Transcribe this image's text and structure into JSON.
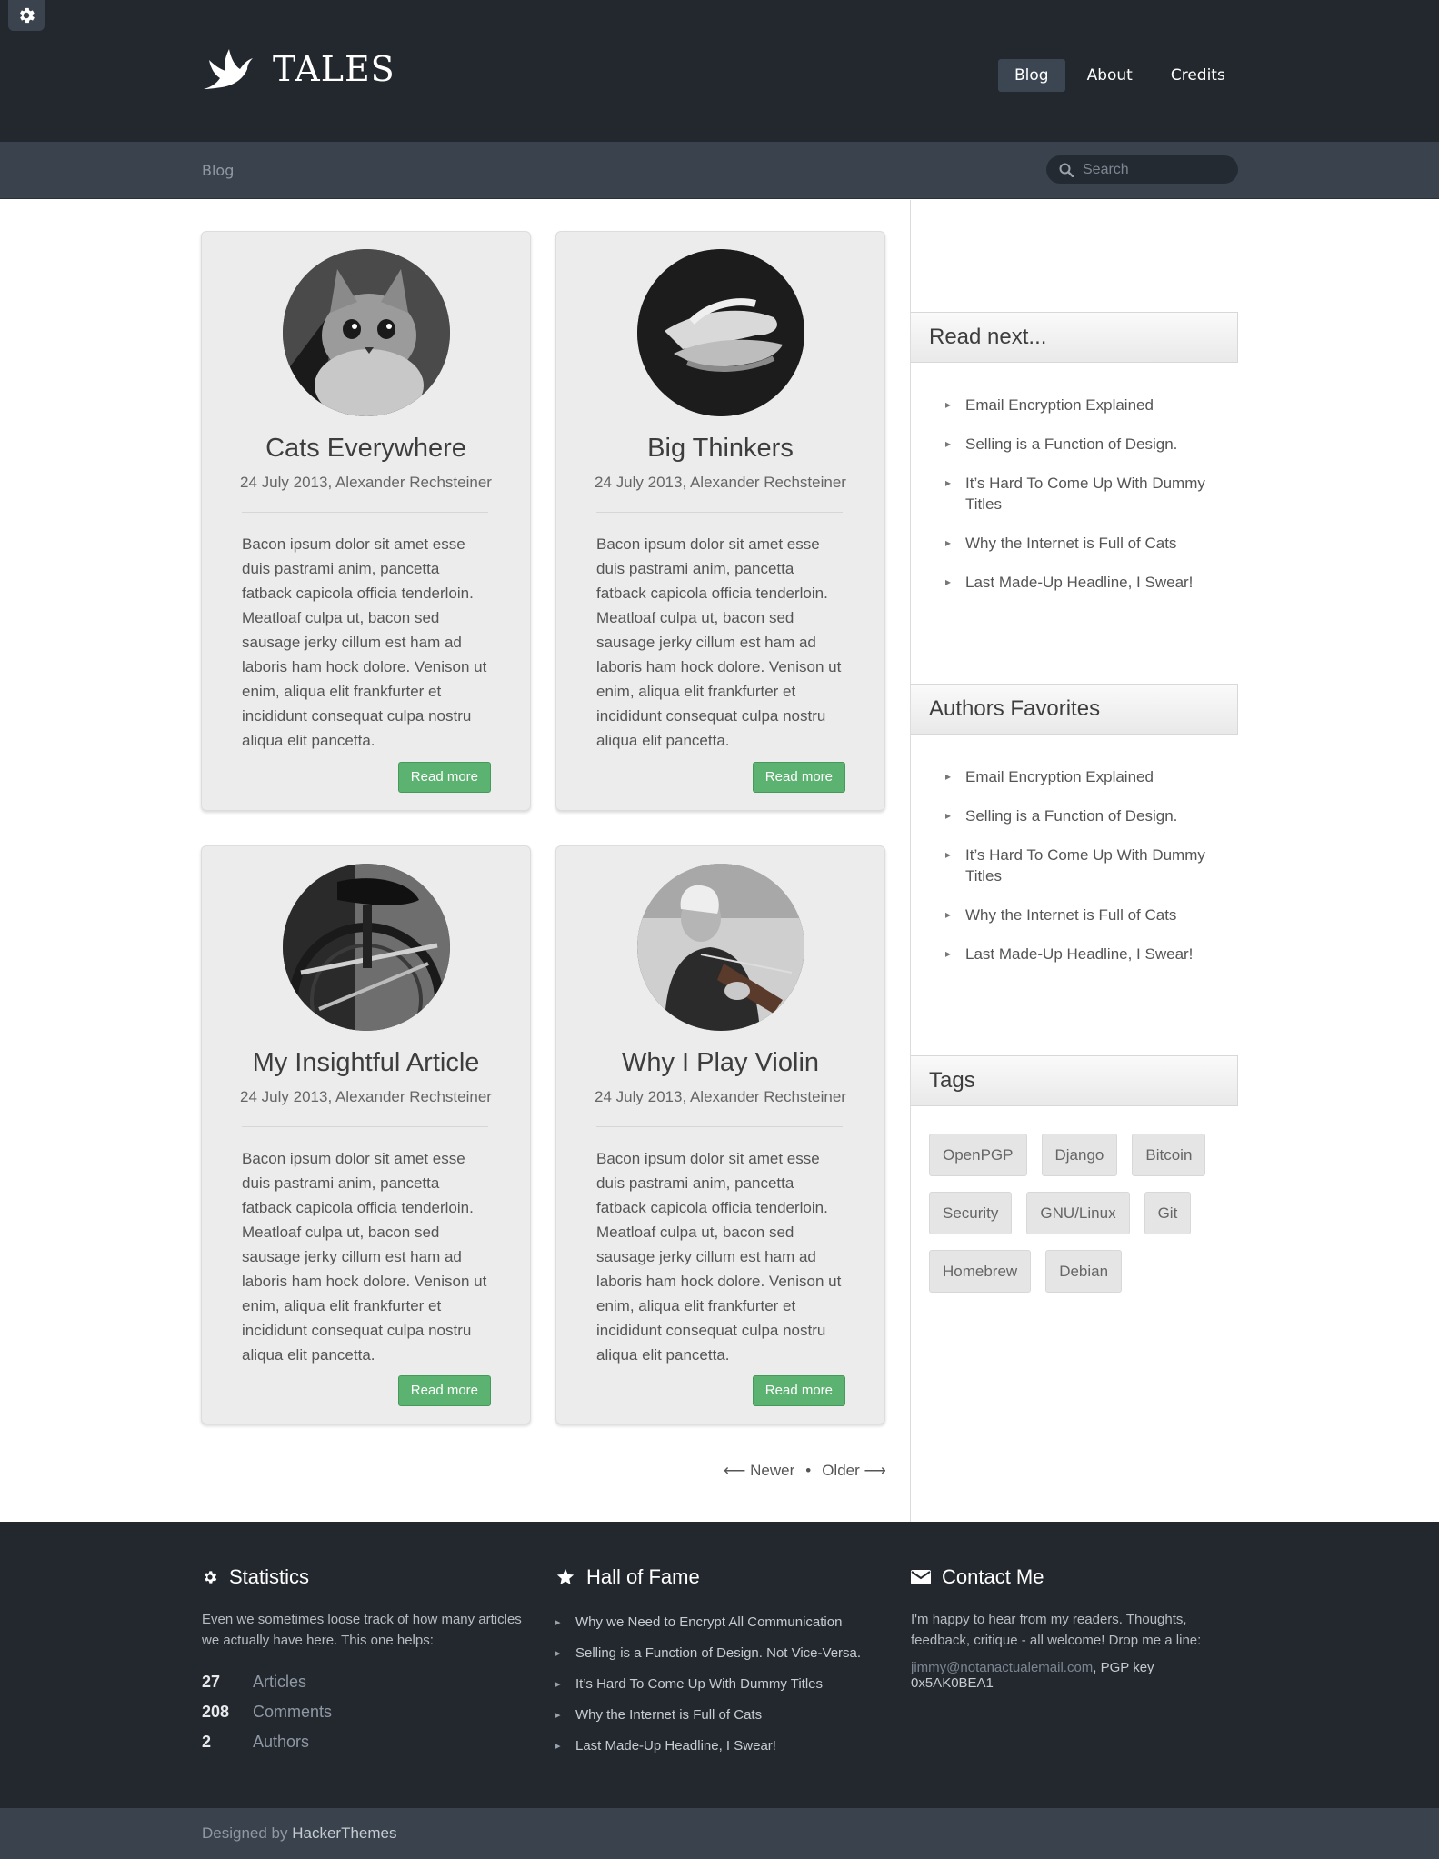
{
  "brand": {
    "name": "TALES"
  },
  "nav": [
    {
      "label": "Blog",
      "active": true
    },
    {
      "label": "About",
      "active": false
    },
    {
      "label": "Credits",
      "active": false
    }
  ],
  "breadcrumb": "Blog",
  "search": {
    "placeholder": "Search"
  },
  "posts": [
    {
      "title": "Cats Everywhere",
      "meta": "24 July 2013, Alexander Rechsteiner",
      "image": "kitten-photo",
      "body": "Bacon ipsum dolor sit amet esse duis pastrami anim, pancetta fatback capicola officia tenderloin. Meatloaf culpa ut, bacon sed sausage jerky cillum est ham ad laboris ham hock dolore. Venison ut enim, aliqua elit frankfurter et incididunt consequat culpa nostru aliqua elit pancetta.",
      "button": "Read more"
    },
    {
      "title": "Big Thinkers",
      "meta": "24 July 2013, Alexander Rechsteiner",
      "image": "hands-photo",
      "body": "Bacon ipsum dolor sit amet esse duis pastrami anim, pancetta fatback capicola officia tenderloin. Meatloaf culpa ut, bacon sed sausage jerky cillum est ham ad laboris ham hock dolore. Venison ut enim, aliqua elit frankfurter et incididunt consequat culpa nostru aliqua elit pancetta.",
      "button": "Read more"
    },
    {
      "title": "My Insightful Article",
      "meta": "24 July 2013, Alexander Rechsteiner",
      "image": "bicycle-photo",
      "body": "Bacon ipsum dolor sit amet esse duis pastrami anim, pancetta fatback capicola officia tenderloin. Meatloaf culpa ut, bacon sed sausage jerky cillum est ham ad laboris ham hock dolore. Venison ut enim, aliqua elit frankfurter et incididunt consequat culpa nostru aliqua elit pancetta.",
      "button": "Read more"
    },
    {
      "title": "Why I Play Violin",
      "meta": "24 July 2013, Alexander Rechsteiner",
      "image": "violinist-photo",
      "body": "Bacon ipsum dolor sit amet esse duis pastrami anim, pancetta fatback capicola officia tenderloin. Meatloaf culpa ut, bacon sed sausage jerky cillum est ham ad laboris ham hock dolore. Venison ut enim, aliqua elit frankfurter et incididunt consequat culpa nostru aliqua elit pancetta.",
      "button": "Read more"
    }
  ],
  "pager": {
    "newer": "Newer",
    "separator": "•",
    "older": "Older"
  },
  "sidebar": {
    "read_next": {
      "title": "Read next...",
      "items": [
        "Email Encryption Explained",
        "Selling is a Function of Design.",
        "It’s Hard To Come Up With Dummy Titles",
        "Why the Internet is Full of Cats",
        "Last Made-Up Headline, I Swear!"
      ]
    },
    "favorites": {
      "title": "Authors Favorites",
      "items": [
        "Email Encryption Explained",
        "Selling is a Function of Design.",
        "It’s Hard To Come Up With Dummy Titles",
        "Why the Internet is Full of Cats",
        "Last Made-Up Headline, I Swear!"
      ]
    },
    "tags": {
      "title": "Tags",
      "items": [
        "OpenPGP",
        "Django",
        "Bitcoin",
        "Security",
        "GNU/Linux",
        "Git",
        "Homebrew",
        "Debian"
      ]
    }
  },
  "footer": {
    "statistics": {
      "title": "Statistics",
      "description": "Even we sometimes loose track of how many articles we actually have here. This one helps:",
      "stats": [
        {
          "value": "27",
          "label": "Articles"
        },
        {
          "value": "208",
          "label": "Comments"
        },
        {
          "value": "2",
          "label": "Authors"
        }
      ]
    },
    "hall_of_fame": {
      "title": "Hall of Fame",
      "items": [
        "Why we Need to Encrypt All Communication",
        "Selling is a Function of Design. Not Vice-Versa.",
        "It’s Hard To Come Up With Dummy Titles",
        "Why the Internet is Full of Cats",
        "Last Made-Up Headline, I Swear!"
      ]
    },
    "contact": {
      "title": "Contact Me",
      "description": "I'm happy to hear from my readers. Thoughts, feedback, critique - all welcome! Drop me a line:",
      "email": "jimmy@notanactualemail.com",
      "pgp": ", PGP key 0x5AK0BEA1"
    }
  },
  "credits": {
    "prefix": "Designed by ",
    "name": "HackerThemes"
  },
  "colors": {
    "header_bg": "#23282f",
    "subbar_bg": "#39424d",
    "button_green": "#5cb270",
    "card_bg": "#ececec"
  },
  "icons": [
    "gear-icon",
    "dove-logo-icon",
    "search-icon",
    "star-icon",
    "envelope-icon"
  ]
}
